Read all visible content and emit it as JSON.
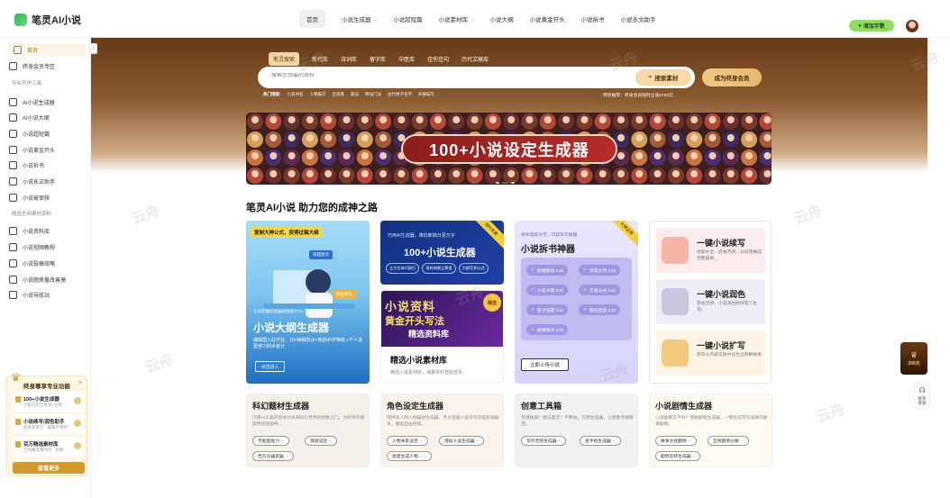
{
  "app": {
    "title": "笔灵AI小说"
  },
  "nav": {
    "items": [
      {
        "label": "首页",
        "active": true,
        "chevron": false
      },
      {
        "label": "小说生成器",
        "active": false,
        "chevron": true
      },
      {
        "label": "小说超短篇",
        "active": false,
        "chevron": false
      },
      {
        "label": "小说素材库",
        "active": false,
        "chevron": true
      },
      {
        "label": "小说大纲",
        "active": false,
        "chevron": false
      },
      {
        "label": "小说黄金开头",
        "active": false,
        "chevron": false
      },
      {
        "label": "小说拆书",
        "active": false,
        "chevron": false
      },
      {
        "label": "小说永文助手",
        "active": false,
        "chevron": false
      }
    ],
    "topup_label": "增加字数"
  },
  "sidebar": {
    "top_items": [
      {
        "label": "首页",
        "active": true,
        "icon": "home-icon"
      },
      {
        "label": "终身会员专区",
        "active": false,
        "icon": "crown-icon"
      }
    ],
    "section1": "专业写作工具",
    "tools": [
      {
        "label": "AI小说生成器",
        "icon": "generator-icon"
      },
      {
        "label": "AI小说大纲",
        "icon": "book-icon"
      },
      {
        "label": "小说超短篇",
        "icon": "file-icon"
      },
      {
        "label": "小说黄金开头",
        "icon": "doc-icon"
      },
      {
        "label": "小说拆书",
        "icon": "split-icon"
      },
      {
        "label": "小说永文助手",
        "icon": "pen-icon"
      },
      {
        "label": "小说被审核",
        "icon": "review-icon"
      }
    ],
    "section2": "精选全网素材资料",
    "materials": [
      {
        "label": "小说资料库",
        "icon": "library-icon"
      },
      {
        "label": "小说视频教程",
        "icon": "video-icon"
      },
      {
        "label": "小说投稿攻略",
        "icon": "guide-icon"
      },
      {
        "label": "小说题质量改善激",
        "icon": "chat-icon"
      },
      {
        "label": "小说导航站",
        "icon": "nav-icon"
      }
    ]
  },
  "vip_panel": {
    "title": "终身尊享专业功能",
    "items": [
      {
        "title": "100+小说生成器",
        "desc": "小说写作全等具, 立指..."
      },
      {
        "title": "小说续写/润色助手",
        "desc": "还会卷草写 · 编辑不预到"
      },
      {
        "title": "百万精选素材库",
        "desc": "丘到精选素材内 · 智能..."
      }
    ],
    "button": "查看更多"
  },
  "hero": {
    "tabs": [
      "笔灵搜索",
      "新代库",
      "诗词库",
      "留字库",
      "中医库",
      "佳伤佳句",
      "历代文献库"
    ],
    "search": {
      "placeholder": "搜索您想要的资料",
      "button": "搜索素材"
    },
    "vip_button": "成为终身会员",
    "hot_label": "热门搜索:",
    "hot_terms": [
      "小说书名",
      "人物描写",
      "吉良香",
      "期法",
      "修仙门派",
      "古代男子名字",
      "外貌描写"
    ],
    "special": "特别推荐：终身会员限时立省¥700元"
  },
  "banner": {
    "title": "100+小说设定生成器"
  },
  "section_title": "笔灵AI小说 助力您的成神之路",
  "card_outline": {
    "tag": "复制大神公式，获得过稿大纲",
    "pill1": "穿越亮点",
    "pill2": "黄金开头",
    "small": "让你更懂读者编辑想看什么",
    "title": "小说大纲生成器",
    "desc": "编辑国入驻作业、10+审稿亮点+黄金40字等级 +千人迭更度力的手度计",
    "button": "点击进入"
  },
  "card_generators": {
    "corner": "限时免费",
    "sub": "巧用AI生成器，降低断稿日更万字",
    "title": "100+小说生成器",
    "chips": [
      "立方位体巧剧行",
      "用有效果立更显",
      "大纲写作公式"
    ]
  },
  "card_material": {
    "img_line1": "小说资料",
    "img_line2": "黄金开头写法",
    "img_line3": "精选资料库",
    "seal": "精选",
    "title": "精选小说素材库",
    "desc": "精选小说素材库，海量资料智能查找"
  },
  "card_split": {
    "sub": "拆你读取文字，可帮写作秘籍",
    "title": "小说拆书神器",
    "corner": "大神必用",
    "pills": [
      "剧情脉络 X10",
      "伏笔文风 X10",
      "小说大纲 X10",
      "方爱公式 X10",
      "看点设置 X15",
      "角色塑造 X10",
      "故事情点 X10"
    ],
    "upload": "立即上传小说"
  },
  "card_tools": {
    "items": [
      {
        "title": "一键小说续写",
        "desc": "智能补全，启发灵感，从段落展成完整篇章。",
        "color": "#fdecec",
        "icon": "pen-icon"
      },
      {
        "title": "一键小说润色",
        "desc": "激发灵感，小说润色助你笔下生花!",
        "color": "#efeef6",
        "icon": "feather-icon"
      },
      {
        "title": "一键小说扩写",
        "desc": "原声从内段实践中化生丝陶瞬故事",
        "color": "#fdf4e5",
        "icon": "expand-icon"
      }
    ]
  },
  "bottom_cards": [
    {
      "title": "科幻题材生成器",
      "desc": "巧用AI工具开启你对未来科幻世界的想象之门。为新手作家提供灵感指导。",
      "bg": "#f5f0ea",
      "buttons": [
        "宇能超能力",
        "等级设定",
        "西方兵器武器"
      ]
    },
    {
      "title": "角色设定生成器",
      "desc": "提供深入的人物描述生成器，无论您是小说写作还是影视剧本，都能自由轻松。",
      "bg": "#fbf3eb",
      "buttons": [
        "人物关系设定",
        "增加人设生成器",
        "批量生成人物..."
      ]
    },
    {
      "title": "创意工具箱",
      "desc": "灵感枯竭？想法匮乏？不要怕，巧用生成器，让想象尽情挥洒。",
      "bg": "#f1f1f3",
      "buttons": [
        "写作灵感生成器",
        "金手指生成器"
      ]
    },
    {
      "title": "小说剧情生成器",
      "desc": "小说剧情写不好？借助剧情生成器，一键生成写引设看的故事剧情。",
      "bg": "#fdf8f0",
      "buttons": [
        "故事主线剧情",
        "互线剧情分解",
        "剧情反转生成器"
      ]
    }
  ],
  "watermark": "云舟",
  "floating": {
    "promo": "299元",
    "contact": "联系客服"
  }
}
